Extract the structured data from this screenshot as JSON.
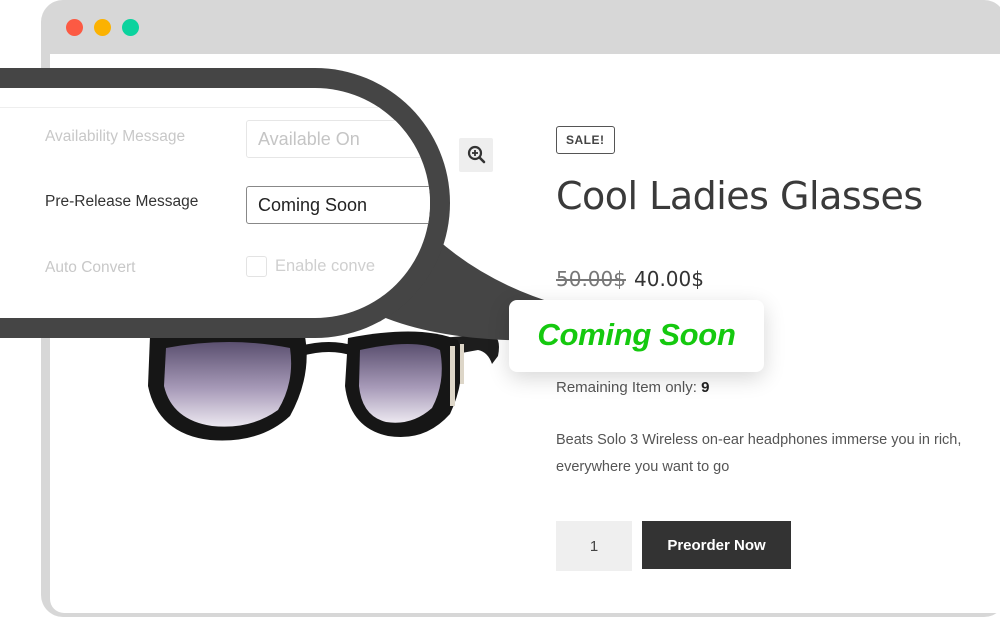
{
  "window": {
    "dots": [
      {
        "name": "close",
        "color": "#fc5a43"
      },
      {
        "name": "minimize",
        "color": "#fbb202"
      },
      {
        "name": "maximize",
        "color": "#0bd39e"
      }
    ]
  },
  "product": {
    "badge": "SALE!",
    "title": "Cool Ladies Glasses",
    "price_old": "50.00$",
    "price_new": "40.00$",
    "remaining_label": "Remaining Item only:",
    "remaining_count": "9",
    "description_line1": "Beats Solo 3 Wireless on-ear headphones immerse you in rich,",
    "description_line2": "everywhere you want to go",
    "quantity": "1",
    "preorder_label": "Preorder Now"
  },
  "settings": {
    "availability_label": "Availability Message",
    "availability_value": "Available On",
    "prerelease_label": "Pre-Release Message",
    "prerelease_value": "Coming Soon",
    "auto_convert_label": "Auto Convert",
    "enable_label": "Enable conve"
  },
  "callout": {
    "text": "Coming Soon",
    "color": "#15c90f"
  },
  "icons": {
    "zoom": "zoom-in-icon"
  }
}
